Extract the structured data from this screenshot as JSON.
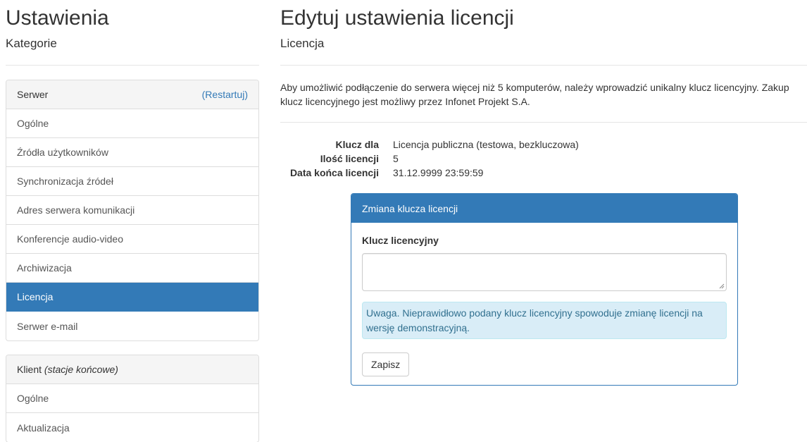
{
  "sidebar": {
    "title": "Ustawienia",
    "subtitle": "Kategorie",
    "server_panel": {
      "heading": "Serwer",
      "restart_link": "(Restartuj)",
      "items": [
        {
          "label": "Ogólne"
        },
        {
          "label": "Źródła użytkowników"
        },
        {
          "label": "Synchronizacja źródeł"
        },
        {
          "label": "Adres serwera komunikacji"
        },
        {
          "label": "Konferencje audio-video"
        },
        {
          "label": "Archiwizacja"
        },
        {
          "label": "Licencja",
          "active": true
        },
        {
          "label": "Serwer e-mail"
        }
      ]
    },
    "client_panel": {
      "heading": "Klient",
      "heading_note": "(stacje końcowe)",
      "items": [
        {
          "label": "Ogólne"
        },
        {
          "label": "Aktualizacja"
        }
      ]
    }
  },
  "main": {
    "title": "Edytuj ustawienia licencji",
    "subtitle": "Licencja",
    "description": "Aby umożliwić podłączenie do serwera więcej niż 5 komputerów, należy wprowadzić unikalny klucz licencyjny. Zakup klucz licencyjnego jest możliwy przez Infonet Projekt S.A.",
    "info": [
      {
        "label": "Klucz dla",
        "value": "Licencja publiczna (testowa, bezkluczowa)"
      },
      {
        "label": "Ilość licencji",
        "value": "5"
      },
      {
        "label": "Data końca licencji",
        "value": "31.12.9999 23:59:59"
      }
    ],
    "license_panel": {
      "heading": "Zmiana klucza licencji",
      "field_label": "Klucz licencyjny",
      "field_value": "",
      "warning": "Uwaga. Nieprawidłowo podany klucz licencyjny spowoduje zmianę licencji na wersję demonstracyjną.",
      "save_label": "Zapisz"
    }
  },
  "colors": {
    "primary": "#337ab7",
    "alert_bg": "#d9edf7",
    "alert_text": "#31708f"
  }
}
